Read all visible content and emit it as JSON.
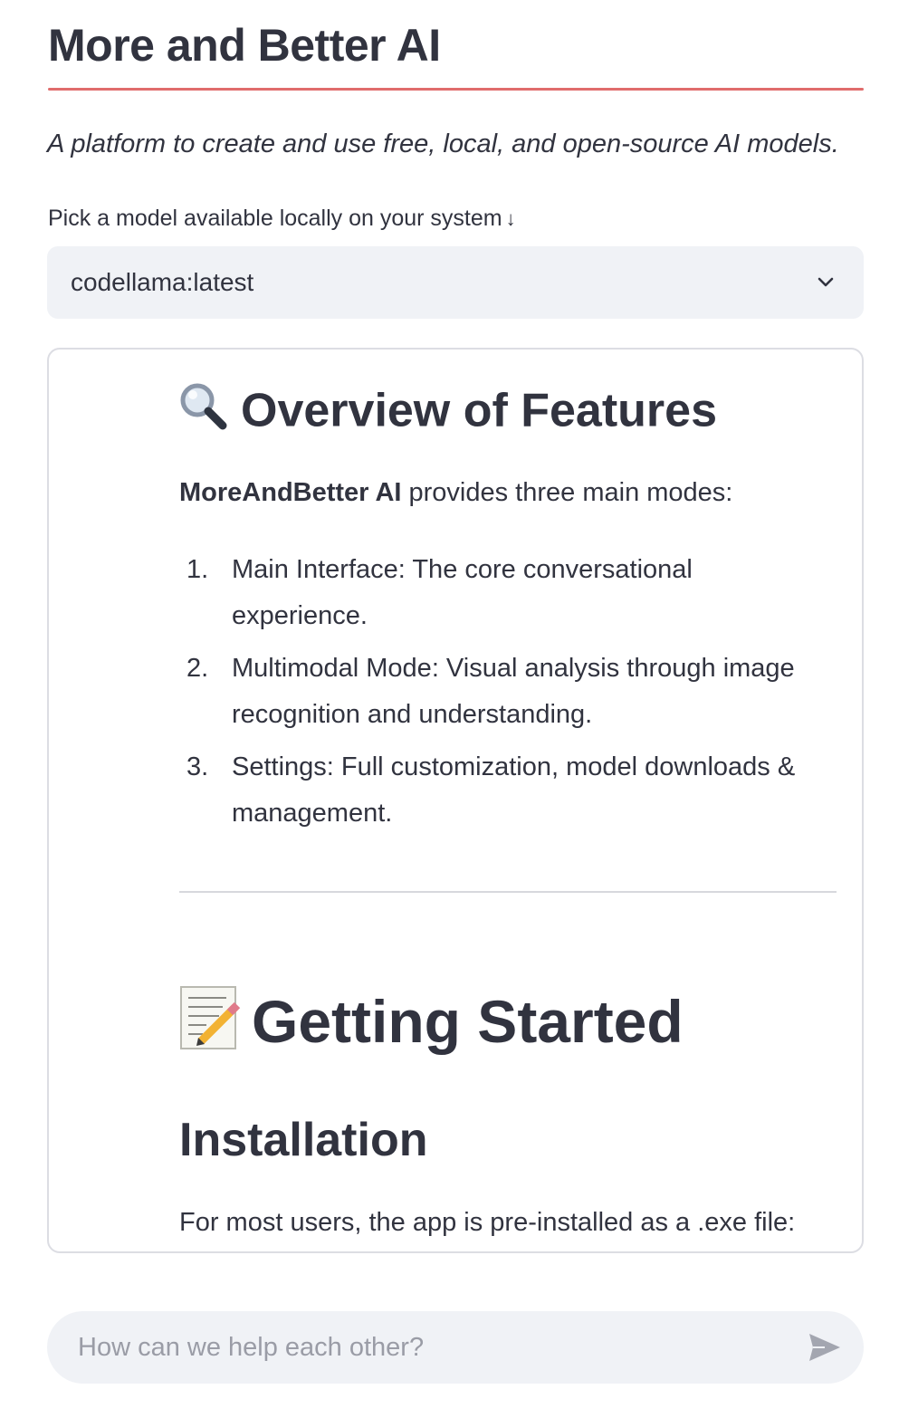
{
  "header": {
    "title": "More and Better AI",
    "subtitle": "A platform to create and use free, local, and open-source AI models."
  },
  "model_select": {
    "label": "Pick a model available locally on your system",
    "label_arrow": "↓",
    "selected": "codellama:latest",
    "icon": "chevron-down-icon"
  },
  "content": {
    "overview_heading": "Overview of Features",
    "overview_icon": "magnifying-glass-icon",
    "intro_bold": "MoreAndBetter AI",
    "intro_rest": " provides three main modes:",
    "modes": [
      {
        "num": "1.",
        "text": "Main Interface: The core conversational experience."
      },
      {
        "num": "2.",
        "text": "Multimodal Mode: Visual analysis through image recognition and understanding."
      },
      {
        "num": "3.",
        "text": "Settings: Full customization, model downloads & management."
      }
    ],
    "getting_started_heading": "Getting Started",
    "getting_started_icon": "memo-icon",
    "installation_heading": "Installation",
    "installation_text": "For most users, the app is pre-installed as a .exe file:"
  },
  "chat": {
    "placeholder": "How can we help each other?",
    "send_icon": "send-icon"
  },
  "colors": {
    "accent_rule": "#e06c6c",
    "text": "#31333f",
    "input_bg": "#f0f2f6",
    "border": "#dcdde3"
  }
}
